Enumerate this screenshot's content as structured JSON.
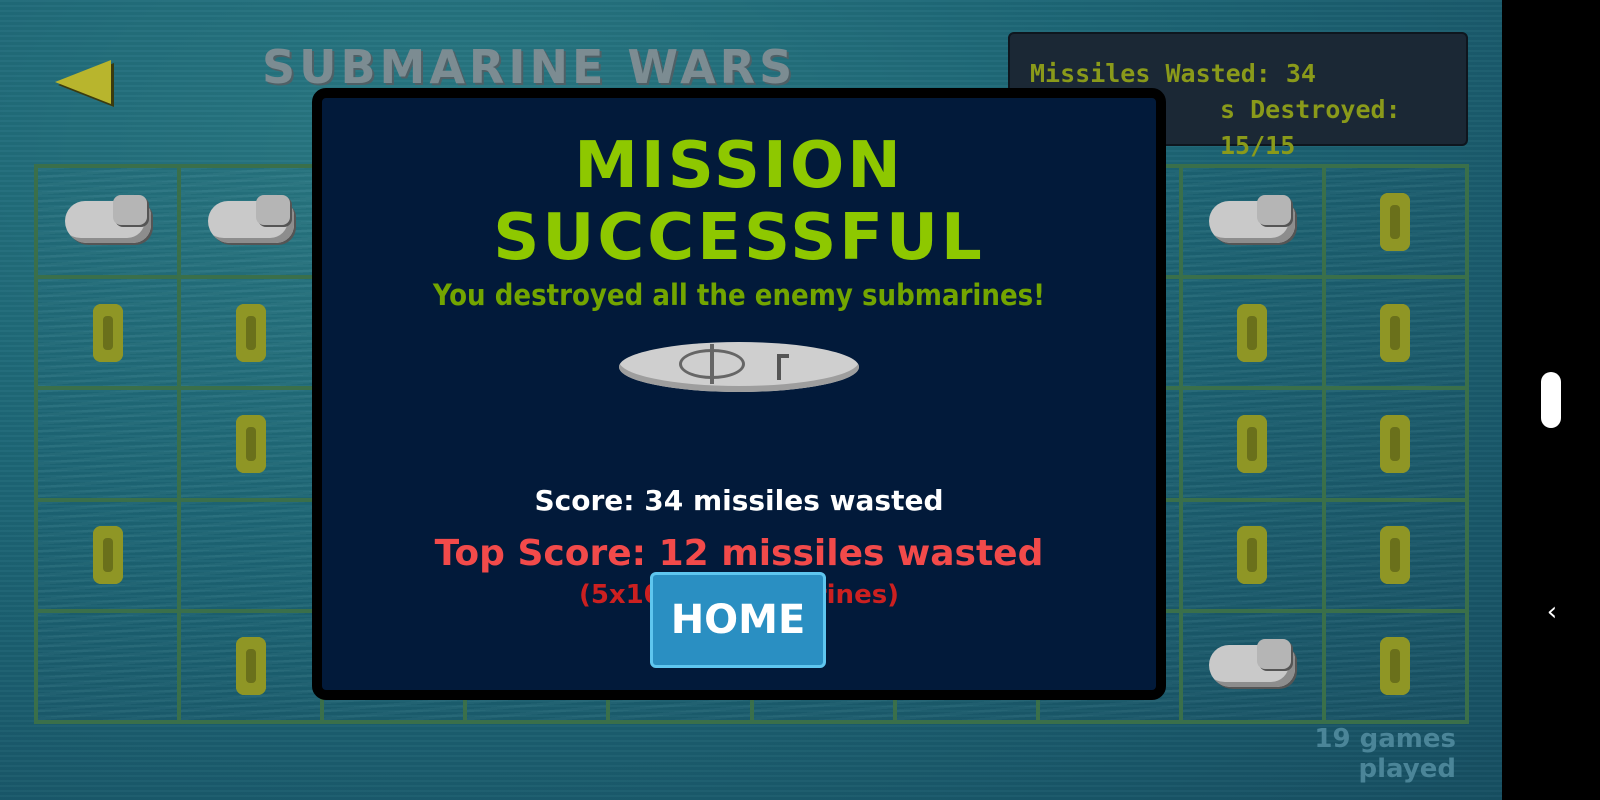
{
  "game": {
    "title": "SUBMARINE WARS",
    "stats": {
      "missiles_wasted": "Missiles Wasted: 34",
      "destroyed": "s Destroyed: 15/15"
    },
    "games_played": "19 games played",
    "grid": [
      [
        "wreck",
        "wreck",
        "",
        "",
        "",
        "",
        "",
        "",
        "wreck",
        "missile"
      ],
      [
        "missile",
        "missile",
        "",
        "",
        "",
        "",
        "",
        "",
        "missile",
        "missile"
      ],
      [
        "",
        "missile",
        "",
        "",
        "",
        "",
        "",
        "",
        "missile",
        "missile"
      ],
      [
        "missile",
        "",
        "",
        "",
        "",
        "",
        "",
        "",
        "missile",
        "missile"
      ],
      [
        "",
        "missile",
        "",
        "",
        "",
        "",
        "",
        "",
        "wreck",
        "missile"
      ]
    ]
  },
  "modal": {
    "title": "MISSION SUCCESSFUL",
    "subtitle": "You destroyed all the enemy submarines!",
    "score": "Score: 34 missiles wasted",
    "top_score": "Top Score: 12 missiles wasted",
    "top_score_detail": "(5x10/15 submarines)",
    "home_button": "HOME"
  },
  "nav": {
    "back_icon": "‹"
  }
}
